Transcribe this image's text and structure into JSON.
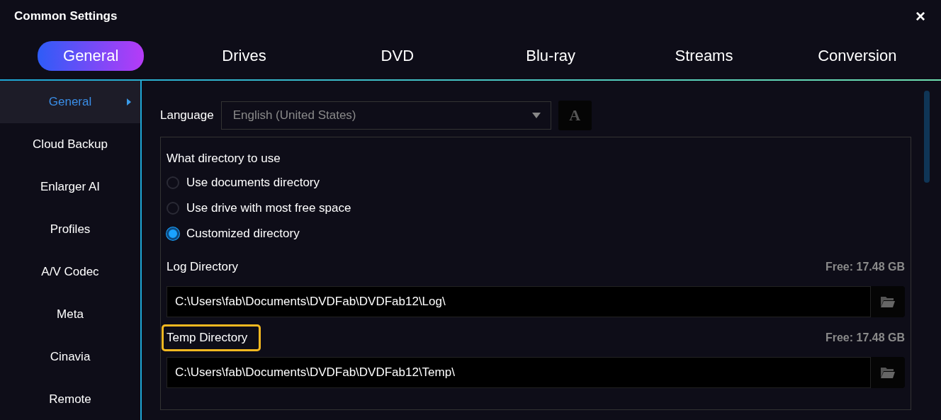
{
  "window": {
    "title": "Common Settings",
    "close": "×"
  },
  "tabs": [
    {
      "label": "General",
      "selected": true
    },
    {
      "label": "Drives",
      "selected": false
    },
    {
      "label": "DVD",
      "selected": false
    },
    {
      "label": "Blu-ray",
      "selected": false
    },
    {
      "label": "Streams",
      "selected": false
    },
    {
      "label": "Conversion",
      "selected": false
    }
  ],
  "sidebar": {
    "items": [
      {
        "label": "General",
        "selected": true
      },
      {
        "label": "Cloud Backup",
        "selected": false
      },
      {
        "label": "Enlarger AI",
        "selected": false
      },
      {
        "label": "Profiles",
        "selected": false
      },
      {
        "label": "A/V Codec",
        "selected": false
      },
      {
        "label": "Meta",
        "selected": false
      },
      {
        "label": "Cinavia",
        "selected": false
      },
      {
        "label": "Remote",
        "selected": false
      }
    ]
  },
  "language": {
    "label": "Language",
    "value": "English (United States)",
    "font_button": "A"
  },
  "directory_group": {
    "heading": "What directory to use",
    "options": [
      {
        "label": "Use documents directory",
        "selected": false
      },
      {
        "label": "Use drive with most free space",
        "selected": false
      },
      {
        "label": "Customized directory",
        "selected": true
      }
    ],
    "directories": [
      {
        "label": "Log Directory",
        "free": "Free: 17.48 GB",
        "path": "C:\\Users\\fab\\Documents\\DVDFab\\DVDFab12\\Log\\",
        "highlighted": false
      },
      {
        "label": "Temp Directory",
        "free": "Free: 17.48 GB",
        "path": "C:\\Users\\fab\\Documents\\DVDFab\\DVDFab12\\Temp\\",
        "highlighted": true
      }
    ]
  }
}
